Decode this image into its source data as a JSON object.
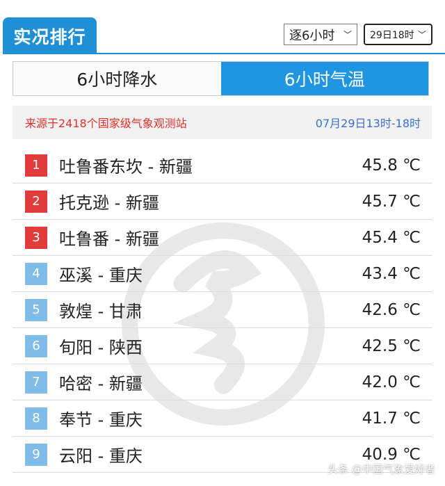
{
  "header": {
    "title": "实况排行",
    "interval_select": "逐6小时",
    "time_select": "29日18时"
  },
  "tabs": [
    {
      "label": "6小时降水",
      "active": false
    },
    {
      "label": "6小时气温",
      "active": true
    }
  ],
  "info": {
    "source": "来源于2418个国家级气象观测站",
    "time_range": "07月29日13时-18时"
  },
  "rankings": [
    {
      "rank": "1",
      "station": "吐鲁番东坎 - 新疆",
      "temp": "45.8 ℃"
    },
    {
      "rank": "2",
      "station": "托克逊 - 新疆",
      "temp": "45.7 ℃"
    },
    {
      "rank": "3",
      "station": "吐鲁番 - 新疆",
      "temp": "45.4 ℃"
    },
    {
      "rank": "4",
      "station": "巫溪 - 重庆",
      "temp": "43.4 ℃"
    },
    {
      "rank": "5",
      "station": "敦煌 - 甘肃",
      "temp": "42.6 ℃"
    },
    {
      "rank": "6",
      "station": "旬阳 - 陕西",
      "temp": "42.5 ℃"
    },
    {
      "rank": "7",
      "station": "哈密 - 新疆",
      "temp": "42.0 ℃"
    },
    {
      "rank": "8",
      "station": "奉节 - 重庆",
      "temp": "41.7 ℃"
    },
    {
      "rank": "9",
      "station": "云阳 - 重庆",
      "temp": "40.9 ℃"
    }
  ],
  "colors": {
    "accent": "#1f8fd6",
    "rank_top": "#e03c3c",
    "rank_other": "#7fbce8",
    "source_text": "#e0312a",
    "time_text": "#3a6fd0"
  },
  "credit": "头条 @中国气象爱好者"
}
